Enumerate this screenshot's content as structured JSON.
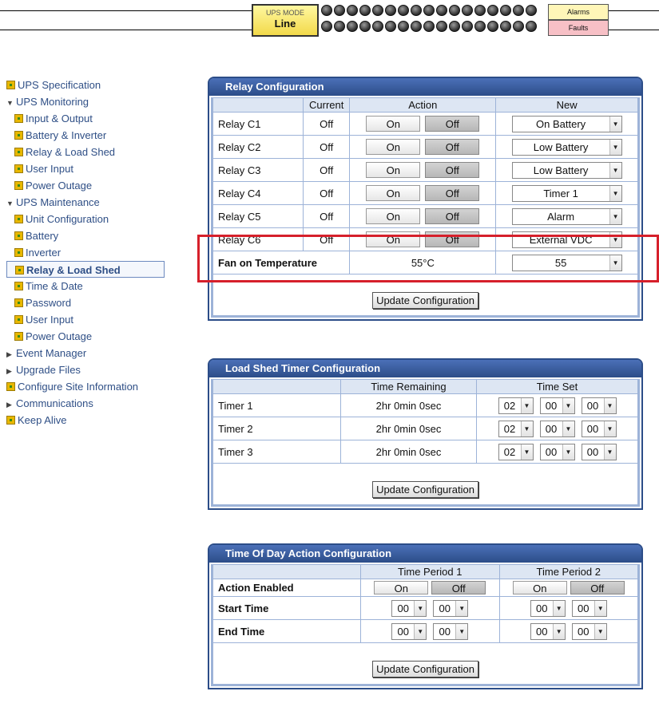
{
  "status_bar": {
    "mode_label": "UPS MODE",
    "mode_value": "Line",
    "alarms_label": "Alarms",
    "faults_label": "Faults"
  },
  "sidebar": {
    "items": [
      {
        "label": "UPS Specification",
        "type": "link"
      },
      {
        "label": "UPS Monitoring",
        "type": "group-open"
      },
      {
        "label": "Input & Output",
        "type": "sub"
      },
      {
        "label": "Battery & Inverter",
        "type": "sub"
      },
      {
        "label": "Relay & Load Shed",
        "type": "sub"
      },
      {
        "label": "User Input",
        "type": "sub"
      },
      {
        "label": "Power Outage",
        "type": "sub"
      },
      {
        "label": "UPS Maintenance",
        "type": "group-open"
      },
      {
        "label": "Unit Configuration",
        "type": "sub"
      },
      {
        "label": "Battery",
        "type": "sub"
      },
      {
        "label": "Inverter",
        "type": "sub"
      },
      {
        "label": "Relay & Load Shed",
        "type": "sub-active"
      },
      {
        "label": "Time & Date",
        "type": "sub"
      },
      {
        "label": "Password",
        "type": "sub"
      },
      {
        "label": "User Input",
        "type": "sub"
      },
      {
        "label": "Power Outage",
        "type": "sub"
      },
      {
        "label": "Event Manager",
        "type": "group-closed"
      },
      {
        "label": "Upgrade Files",
        "type": "group-closed"
      },
      {
        "label": "Configure Site Information",
        "type": "link"
      },
      {
        "label": "Communications",
        "type": "group-closed"
      },
      {
        "label": "Keep Alive",
        "type": "link"
      }
    ]
  },
  "relay_config": {
    "title": "Relay Configuration",
    "headers": {
      "current": "Current",
      "action": "Action",
      "new": "New"
    },
    "on_label": "On",
    "off_label": "Off",
    "rows": [
      {
        "name": "Relay C1",
        "current": "Off",
        "new": "On Battery"
      },
      {
        "name": "Relay C2",
        "current": "Off",
        "new": "Low Battery"
      },
      {
        "name": "Relay C3",
        "current": "Off",
        "new": "Low Battery"
      },
      {
        "name": "Relay C4",
        "current": "Off",
        "new": "Timer 1"
      },
      {
        "name": "Relay C5",
        "current": "Off",
        "new": "Alarm"
      },
      {
        "name": "Relay C6",
        "current": "Off",
        "new": "External VDC"
      }
    ],
    "fan": {
      "name": "Fan on Temperature",
      "value": "55°C",
      "new": "55"
    },
    "update_label": "Update Configuration"
  },
  "load_shed": {
    "title": "Load Shed Timer Configuration",
    "headers": {
      "remaining": "Time Remaining",
      "set": "Time Set"
    },
    "rows": [
      {
        "name": "Timer 1",
        "remaining": "2hr 0min 0sec",
        "h": "02",
        "m": "00",
        "s": "00"
      },
      {
        "name": "Timer 2",
        "remaining": "2hr 0min 0sec",
        "h": "02",
        "m": "00",
        "s": "00"
      },
      {
        "name": "Timer 3",
        "remaining": "2hr 0min 0sec",
        "h": "02",
        "m": "00",
        "s": "00"
      }
    ],
    "update_label": "Update Configuration"
  },
  "time_of_day": {
    "title": "Time Of Day Action Configuration",
    "headers": {
      "period1": "Time Period 1",
      "period2": "Time Period 2"
    },
    "action_enabled": {
      "name": "Action Enabled",
      "on": "On",
      "off": "Off"
    },
    "start": {
      "name": "Start Time",
      "p1h": "00",
      "p1m": "00",
      "p2h": "00",
      "p2m": "00"
    },
    "end": {
      "name": "End Time",
      "p1h": "00",
      "p1m": "00",
      "p2h": "00",
      "p2m": "00"
    },
    "update_label": "Update Configuration"
  },
  "colors": {
    "panel_header": "#2c4d88",
    "nav_link": "#2f4f86",
    "highlight_box": "#d6202b",
    "mode_box": "#f2d94a",
    "faults_box": "#f7c0c6"
  }
}
